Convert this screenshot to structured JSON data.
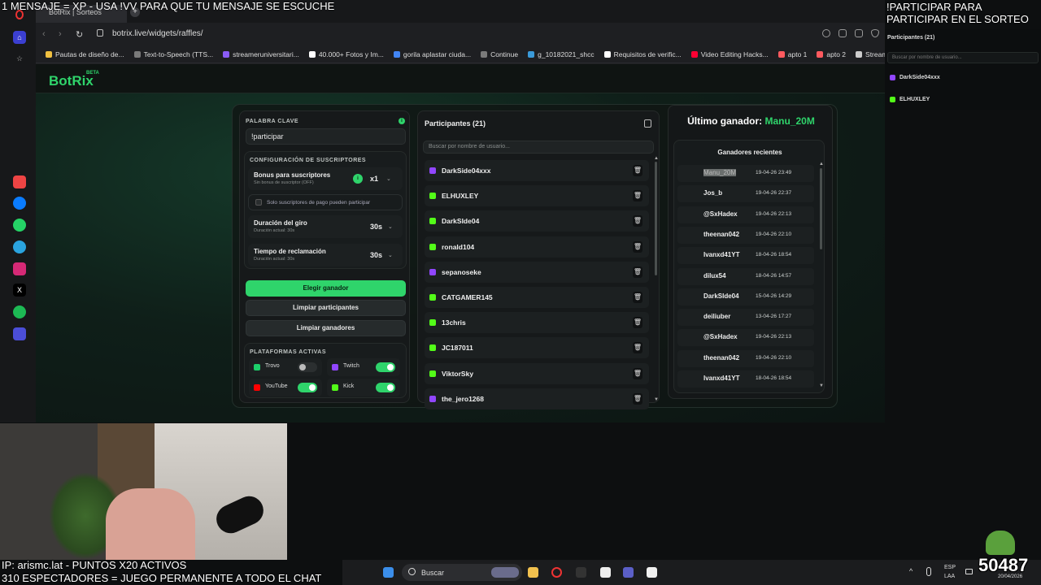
{
  "overlay": {
    "top_left": "1 MENSAJE = XP - USA !VV PARA QUE TU MENSAJE SE ESCUCHE",
    "top_right_line1": "!PARTICIPAR PARA",
    "top_right_line2": "PARTICIPAR EN EL SORTEO",
    "bottom_line1": "IP: arismc.lat - PUNTOS X20 ACTIVOS",
    "bottom_line2": "310 ESPECTADORES = JUEGO PERMANENTE A TODO EL CHAT",
    "counter": "50487"
  },
  "browser": {
    "tab_title": "BotRix | Sorteos",
    "url": "botrix.live/widgets/raffles/",
    "bookmarks": [
      {
        "label": "Pautas de diseño de...",
        "color": "#f0c040"
      },
      {
        "label": "Text-to-Speech (TTS...",
        "color": "#7a7a7a"
      },
      {
        "label": "streameruniversitari...",
        "color": "#8a5cf6"
      },
      {
        "label": "40.000+ Fotos y Im...",
        "color": "#ffffff"
      },
      {
        "label": "gorila aplastar ciuda...",
        "color": "#4285f4"
      },
      {
        "label": "Continue",
        "color": "#7a7a7a"
      },
      {
        "label": "g_10182021_shcc",
        "color": "#3a9ad9"
      },
      {
        "label": "Requisitos de verific...",
        "color": "#ffffff"
      },
      {
        "label": "Video Editing Hacks...",
        "color": "#ff0033"
      },
      {
        "label": "apto 1",
        "color": "#ff5a5f"
      },
      {
        "label": "apto 2",
        "color": "#ff5a5f"
      },
      {
        "label": "StreamElements - st...",
        "color": "#cccccc"
      }
    ]
  },
  "app": {
    "logo": "BotRix",
    "logo_badge": "BETA"
  },
  "settings": {
    "keyword_label": "PALABRA CLAVE",
    "keyword_value": "!participar",
    "subs_section": "CONFIGURACIÓN DE SUSCRIPTORES",
    "bonus_title": "Bonus para suscriptores",
    "bonus_sub": "Sin bonus de suscriptor (OFF)",
    "bonus_value": "x1",
    "paid_only": "Solo suscriptores de pago pueden participar",
    "spin_title": "Duración del giro",
    "spin_sub": "Duración actual: 30s",
    "spin_value": "30s",
    "claim_title": "Tiempo de reclamación",
    "claim_sub": "Duración actual: 30s",
    "claim_value": "30s",
    "pick_winner": "Elegir ganador",
    "clear_participants": "Limpiar participantes",
    "clear_winners": "Limpiar ganadores",
    "platforms_label": "PLATAFORMAS ACTIVAS",
    "platforms": [
      {
        "name": "Trovo",
        "on": false,
        "color": "#1ccf6a"
      },
      {
        "name": "Twitch",
        "on": true,
        "color": "#9146ff"
      },
      {
        "name": "YouTube",
        "on": true,
        "color": "#ff0000"
      },
      {
        "name": "Kick",
        "on": true,
        "color": "#53fc18"
      }
    ]
  },
  "participants": {
    "title": "Participantes (21)",
    "search_placeholder": "Buscar por nombre de usuario...",
    "rows": [
      {
        "name": "DarkSide04xxx",
        "platform": "twitch"
      },
      {
        "name": "ELHUXLEY",
        "platform": "kick"
      },
      {
        "name": "DarkSIde04",
        "platform": "kick"
      },
      {
        "name": "ronald104",
        "platform": "kick"
      },
      {
        "name": "sepanoseke",
        "platform": "twitch"
      },
      {
        "name": "CATGAMER145",
        "platform": "kick"
      },
      {
        "name": "13chris",
        "platform": "kick"
      },
      {
        "name": "JC187011",
        "platform": "kick"
      },
      {
        "name": "ViktorSky",
        "platform": "kick"
      },
      {
        "name": "the_jero1268",
        "platform": "twitch"
      }
    ]
  },
  "winners": {
    "last_label": "Último ganador:",
    "last_name": "Manu_20M",
    "recent_title": "Ganadores recientes",
    "rows": [
      {
        "name": "Manu_20M",
        "date": "19-04-26 23:49"
      },
      {
        "name": "Jos_b",
        "date": "19-04-26 22:37"
      },
      {
        "name": "@SxHadex",
        "date": "19-04-26 22:13"
      },
      {
        "name": "theenan042",
        "date": "19-04-26 22:10"
      },
      {
        "name": "Ivanxd41YT",
        "date": "18-04-26 18:54"
      },
      {
        "name": "dilux54",
        "date": "18-04-26 14:57"
      },
      {
        "name": "DarkSIde04",
        "date": "15-04-26 14:29"
      },
      {
        "name": "deiliuber",
        "date": "13-04-26 17:27"
      },
      {
        "name": "@SxHadex",
        "date": "19-04-26 22:13"
      },
      {
        "name": "theenan042",
        "date": "19-04-26 22:10"
      },
      {
        "name": "Ivanxd41YT",
        "date": "18-04-26 18:54"
      }
    ]
  },
  "side_panel": {
    "title": "Participantes (21)",
    "search_placeholder": "Buscar por nombre de usuario...",
    "rows": [
      "DarkSide04xxx",
      "ELHUXLEY"
    ]
  },
  "taskbar": {
    "search": "Buscar",
    "lang1": "ESP",
    "lang2": "LAA",
    "date": "20/04/2026"
  },
  "colors": {
    "accent": "#2fd46b",
    "twitch": "#9146ff",
    "kick": "#53fc18"
  }
}
